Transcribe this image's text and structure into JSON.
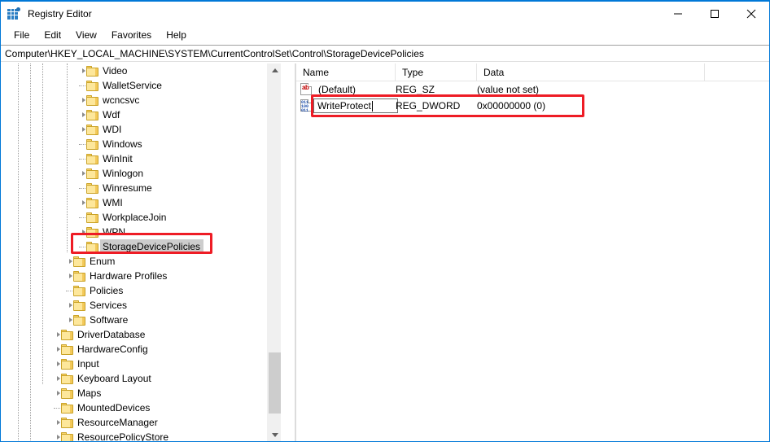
{
  "window": {
    "title": "Registry Editor",
    "icon": "registry-editor-icon",
    "accent_color": "#0078d7",
    "controls": [
      {
        "name": "minimize-button",
        "glyph": "minimize-icon"
      },
      {
        "name": "maximize-button",
        "glyph": "maximize-icon"
      },
      {
        "name": "close-button",
        "glyph": "close-icon"
      }
    ]
  },
  "menubar": {
    "items": [
      "File",
      "Edit",
      "View",
      "Favorites",
      "Help"
    ]
  },
  "address_bar": {
    "path": "Computer\\HKEY_LOCAL_MACHINE\\SYSTEM\\CurrentControlSet\\Control\\StorageDevicePolicies"
  },
  "tree": {
    "items": [
      {
        "label": "Video",
        "level": 4,
        "expander": true,
        "selected": false
      },
      {
        "label": "WalletService",
        "level": 4,
        "expander": false,
        "selected": false
      },
      {
        "label": "wcncsvc",
        "level": 4,
        "expander": true,
        "selected": false
      },
      {
        "label": "Wdf",
        "level": 4,
        "expander": true,
        "selected": false
      },
      {
        "label": "WDI",
        "level": 4,
        "expander": true,
        "selected": false
      },
      {
        "label": "Windows",
        "level": 4,
        "expander": false,
        "selected": false
      },
      {
        "label": "WinInit",
        "level": 4,
        "expander": false,
        "selected": false
      },
      {
        "label": "Winlogon",
        "level": 4,
        "expander": true,
        "selected": false
      },
      {
        "label": "Winresume",
        "level": 4,
        "expander": false,
        "selected": false
      },
      {
        "label": "WMI",
        "level": 4,
        "expander": true,
        "selected": false
      },
      {
        "label": "WorkplaceJoin",
        "level": 4,
        "expander": false,
        "selected": false
      },
      {
        "label": "WPN",
        "level": 4,
        "expander": true,
        "selected": false
      },
      {
        "label": "StorageDevicePolicies",
        "level": 4,
        "expander": false,
        "selected": true
      },
      {
        "label": "Enum",
        "level": 3,
        "expander": true,
        "selected": false
      },
      {
        "label": "Hardware Profiles",
        "level": 3,
        "expander": true,
        "selected": false
      },
      {
        "label": "Policies",
        "level": 3,
        "expander": false,
        "selected": false
      },
      {
        "label": "Services",
        "level": 3,
        "expander": true,
        "selected": false
      },
      {
        "label": "Software",
        "level": 3,
        "expander": true,
        "selected": false
      },
      {
        "label": "DriverDatabase",
        "level": 2,
        "expander": true,
        "selected": false
      },
      {
        "label": "HardwareConfig",
        "level": 2,
        "expander": true,
        "selected": false
      },
      {
        "label": "Input",
        "level": 2,
        "expander": true,
        "selected": false
      },
      {
        "label": "Keyboard Layout",
        "level": 2,
        "expander": true,
        "selected": false
      },
      {
        "label": "Maps",
        "level": 2,
        "expander": true,
        "selected": false
      },
      {
        "label": "MountedDevices",
        "level": 2,
        "expander": false,
        "selected": false
      },
      {
        "label": "ResourceManager",
        "level": 2,
        "expander": true,
        "selected": false
      },
      {
        "label": "ResourcePolicyStore",
        "level": 2,
        "expander": true,
        "selected": false
      }
    ],
    "scrollbar": {
      "name": "tree-vertical-scrollbar"
    }
  },
  "values_list": {
    "columns": [
      "Name",
      "Type",
      "Data"
    ],
    "rows": [
      {
        "icon": "string-value-icon",
        "name": "(Default)",
        "type": "REG_SZ",
        "data": "(value not set)",
        "editing": false
      },
      {
        "icon": "dword-value-icon",
        "name": "WriteProtect",
        "type": "REG_DWORD",
        "data": "0x00000000 (0)",
        "editing": true
      }
    ]
  },
  "annotations": {
    "highlight_color": "#ee1c25",
    "boxes": [
      {
        "name": "highlight-storagedevicepolicies-key"
      },
      {
        "name": "highlight-writeprotect-value"
      }
    ]
  }
}
